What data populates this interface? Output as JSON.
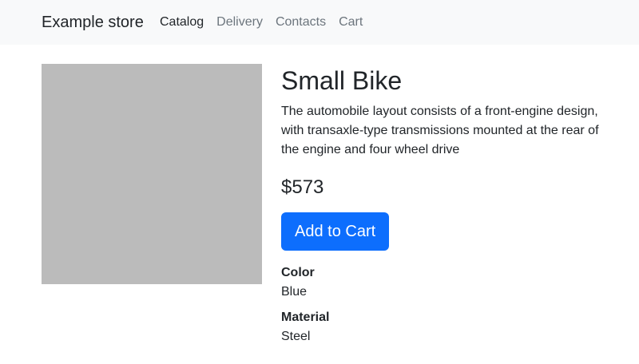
{
  "navbar": {
    "brand": "Example store",
    "links": [
      {
        "label": "Catalog",
        "active": true
      },
      {
        "label": "Delivery",
        "active": false
      },
      {
        "label": "Contacts",
        "active": false
      },
      {
        "label": "Cart",
        "active": false
      }
    ]
  },
  "product": {
    "title": "Small Bike",
    "description": "The automobile layout consists of a front-engine design, with transaxle-type transmissions mounted at the rear of the engine and four wheel drive",
    "price": "$573",
    "add_to_cart_label": "Add to Cart",
    "image_color": "#bbbbbb",
    "attributes": [
      {
        "label": "Color",
        "value": "Blue"
      },
      {
        "label": "Material",
        "value": "Steel"
      }
    ]
  },
  "colors": {
    "navbar_bg": "#f8f9fa",
    "button_bg": "#0d6efd"
  }
}
